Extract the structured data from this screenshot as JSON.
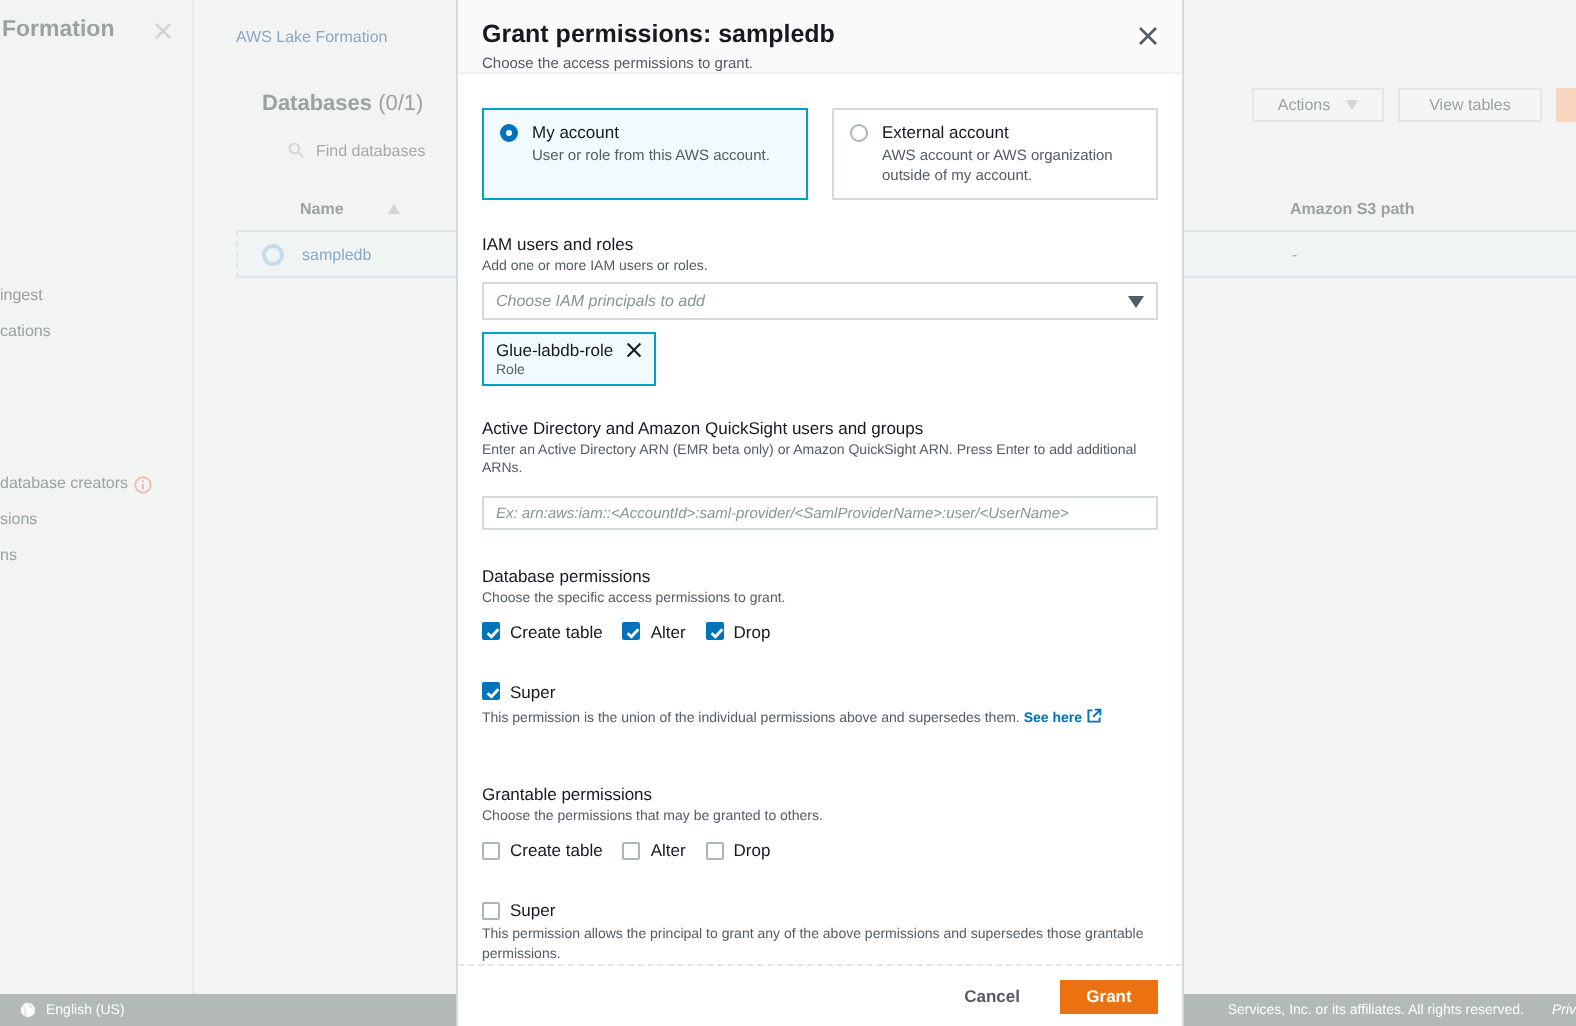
{
  "console": {
    "sidebar": {
      "title": "Formation",
      "items": [
        {
          "label": "ingest",
          "info": false
        },
        {
          "label": "cations",
          "info": false
        },
        {
          "label": "database creators",
          "info": true
        },
        {
          "label": "sions",
          "info": false
        },
        {
          "label": "ns",
          "info": false
        }
      ]
    },
    "breadcrumb": "AWS Lake Formation",
    "databases": {
      "title": "Databases",
      "count": "(0/1)",
      "search_placeholder": "Find databases",
      "actions": [
        "Actions",
        "View tables"
      ],
      "columns": [
        "Name",
        "Amazon S3 path"
      ],
      "rows": [
        {
          "name": "sampledb",
          "s3_path": "-",
          "selected": false
        }
      ]
    },
    "footer": {
      "language": "English (US)",
      "copyright": "Services, Inc. or its affiliates. All rights reserved.",
      "link": "Priv"
    }
  },
  "dialog": {
    "title": "Grant permissions: sampledb",
    "subtitle": "Choose the access permissions to grant.",
    "account_options": [
      {
        "label": "My account",
        "description": "User or role from this AWS account.",
        "selected": true
      },
      {
        "label": "External account",
        "description": "AWS account or AWS organization outside of my account.",
        "selected": false
      }
    ],
    "iam": {
      "label": "IAM users and roles",
      "hint": "Add one or more IAM users or roles.",
      "placeholder": "Choose IAM principals to add",
      "tokens": [
        {
          "name": "Glue-labdb-role",
          "type": "Role"
        }
      ]
    },
    "directory": {
      "label": "Active Directory and Amazon QuickSight users and groups",
      "hint": "Enter an Active Directory ARN (EMR beta only) or Amazon QuickSight ARN. Press Enter to add additional ARNs.",
      "placeholder": "Ex: arn:aws:iam::<AccountId>:saml-provider/<SamlProviderName>:user/<UserName>"
    },
    "permission_groups": [
      {
        "label": "Database permissions",
        "hint": "Choose the specific access permissions to grant.",
        "options": [
          {
            "label": "Create table",
            "checked": true
          },
          {
            "label": "Alter",
            "checked": true
          },
          {
            "label": "Drop",
            "checked": true
          }
        ],
        "super": {
          "label": "Super",
          "checked": true,
          "description": "This permission is the union of the individual permissions above and supersedes them.",
          "link": "See here"
        }
      },
      {
        "label": "Grantable permissions",
        "hint": "Choose the permissions that may be granted to others.",
        "options": [
          {
            "label": "Create table",
            "checked": false
          },
          {
            "label": "Alter",
            "checked": false
          },
          {
            "label": "Drop",
            "checked": false
          }
        ],
        "super": {
          "label": "Super",
          "checked": false,
          "description": "This permission allows the principal to grant any of the above permissions and supersedes those grantable permissions."
        }
      }
    ],
    "buttons": {
      "cancel": "Cancel",
      "confirm": "Grant"
    }
  }
}
